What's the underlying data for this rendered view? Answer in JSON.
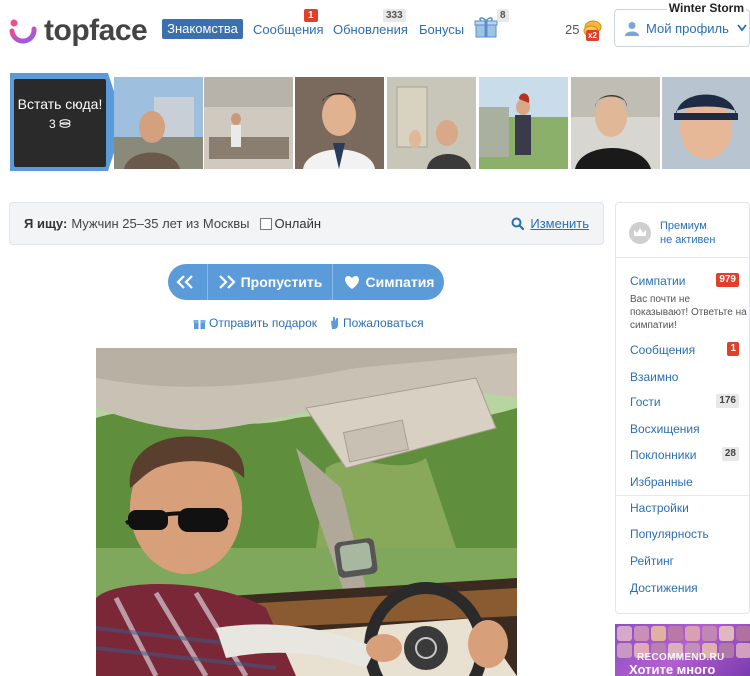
{
  "header": {
    "logo_text": "topface",
    "nav": {
      "dating": "Знакомства",
      "messages": "Сообщения",
      "messages_badge": "1",
      "updates": "Обновления",
      "updates_badge": "333",
      "bonuses": "Бонусы",
      "gifts_badge": "8"
    },
    "coins_count": "25",
    "coins_multiplier": "x2",
    "profile_label": "Мой профиль",
    "username": "Winter Storm"
  },
  "strip": {
    "stand_here": "Встать сюда!",
    "stand_price": "3"
  },
  "search": {
    "label": "Я ищу:",
    "criteria": "Мужчин  25–35 лет из Москвы",
    "online_label": "Онлайн",
    "change_label": "Изменить"
  },
  "actions": {
    "skip_label": "Пропустить",
    "like_label": "Симпатия",
    "send_gift": "Отправить подарок",
    "complain": "Пожаловаться"
  },
  "sidebar": {
    "premium_line1": "Премиум",
    "premium_line2": "не активен",
    "likes_label": "Симпатии",
    "likes_badge": "979",
    "likes_note": "Вас почти не показывают! Ответьте на симпатии!",
    "messages_label": "Сообщения",
    "messages_badge": "1",
    "mutual_label": "Взаимно",
    "guests_label": "Гости",
    "guests_badge": "176",
    "admirations_label": "Восхищения",
    "fans_label": "Поклонники",
    "fans_badge": "28",
    "favorites_label": "Избранные",
    "settings_label": "Настройки",
    "popularity_label": "Популярность",
    "rating_label": "Рейтинг",
    "achievements_label": "Достижения"
  },
  "ad": {
    "text": "Хотите много",
    "watermark": "RECOMMEND.RU"
  },
  "colors": {
    "brand_blue": "#3a6fb0",
    "link_blue": "#2a6fb5",
    "button_blue": "#5b9bd9",
    "badge_red": "#e0402a"
  }
}
